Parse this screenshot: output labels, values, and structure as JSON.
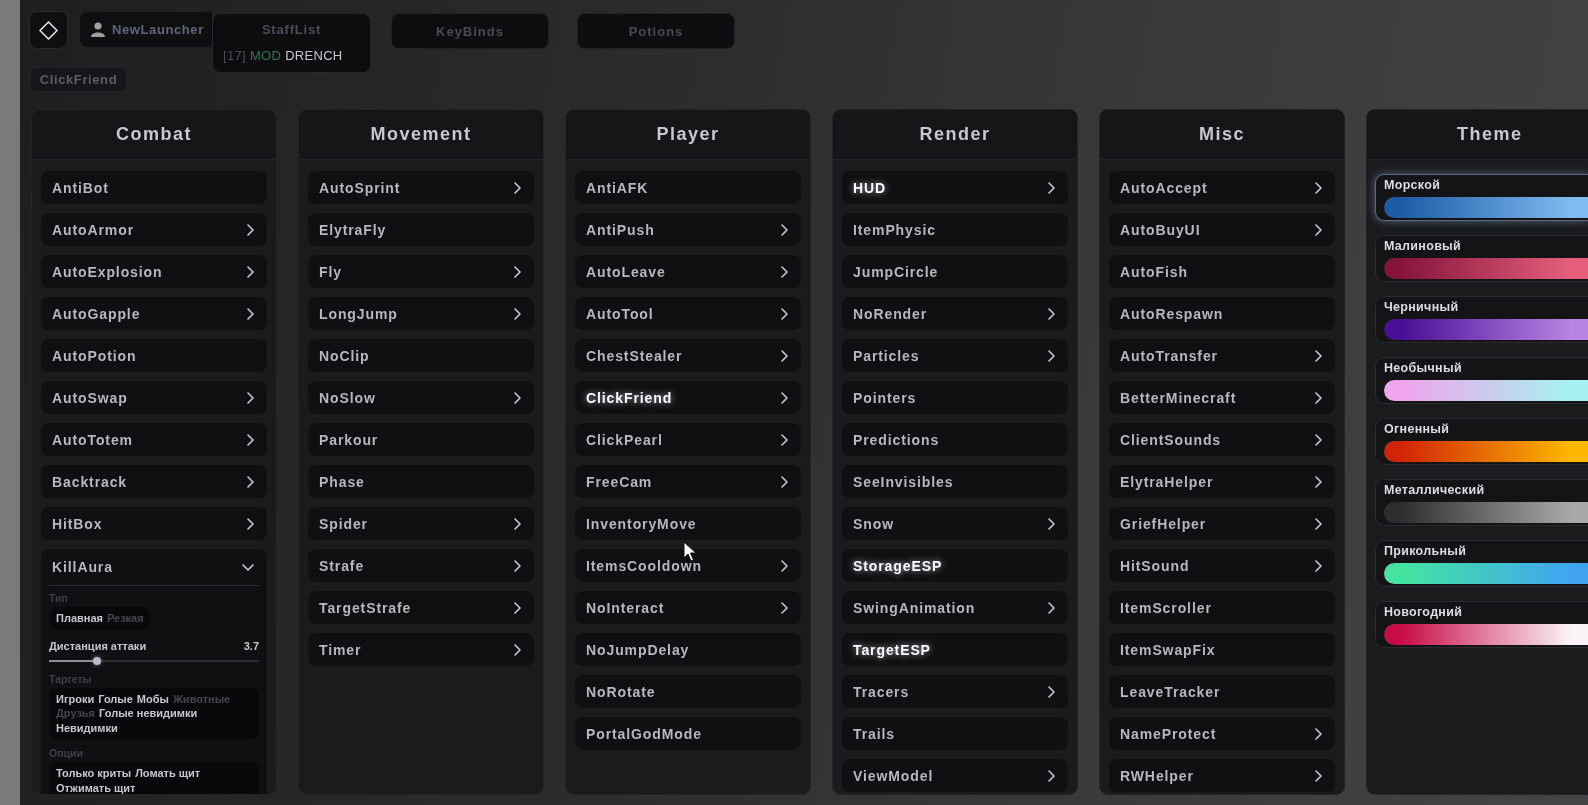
{
  "hud": {
    "watermark": "NewLauncher",
    "staff_list": {
      "title": "StaffList",
      "entries": [
        {
          "prefix": "[17]",
          "role": "MOD",
          "name": "DRENCH",
          "color": "#2f7a4c"
        }
      ]
    },
    "panels": [
      "KeyBinds",
      "Potions"
    ],
    "module_tag": "ClickFriend"
  },
  "categories": [
    {
      "title": "Combat",
      "modules": [
        {
          "label": "AntiBot",
          "kind": "toggle",
          "enabled": false,
          "expanded": false
        },
        {
          "label": "AutoArmor",
          "kind": "submenu",
          "enabled": false,
          "expanded": false
        },
        {
          "label": "AutoExplosion",
          "kind": "submenu",
          "enabled": false,
          "expanded": false
        },
        {
          "label": "AutoGapple",
          "kind": "submenu",
          "enabled": false,
          "expanded": false
        },
        {
          "label": "AutoPotion",
          "kind": "toggle",
          "enabled": false,
          "expanded": false
        },
        {
          "label": "AutoSwap",
          "kind": "submenu",
          "enabled": false,
          "expanded": false
        },
        {
          "label": "AutoTotem",
          "kind": "submenu",
          "enabled": false,
          "expanded": false
        },
        {
          "label": "Backtrack",
          "kind": "submenu",
          "enabled": false,
          "expanded": false
        },
        {
          "label": "HitBox",
          "kind": "submenu",
          "enabled": false,
          "expanded": false
        },
        {
          "label": "KillAura",
          "kind": "submenu",
          "enabled": false,
          "expanded": true,
          "settings": [
            {
              "kind": "mode",
              "label": "Тип",
              "options": [
                {
                  "label": "Плавная",
                  "selected": true
                },
                {
                  "label": "Резкая",
                  "selected": false
                }
              ]
            },
            {
              "kind": "slider",
              "label": "Дистанция аттаки",
              "reading": "3.7",
              "level": 0.23
            },
            {
              "kind": "multi",
              "label": "Таргеты",
              "options": [
                {
                  "label": "Игроки",
                  "selected": true
                },
                {
                  "label": "Голые",
                  "selected": true
                },
                {
                  "label": "Мобы",
                  "selected": true
                },
                {
                  "label": "Животные",
                  "selected": false
                },
                {
                  "label": "Друзья",
                  "selected": false
                },
                {
                  "label": "Голые невидимки",
                  "selected": true
                },
                {
                  "label": "Невидимки",
                  "selected": true
                }
              ]
            },
            {
              "kind": "multi",
              "label": "Опции",
              "options": [
                {
                  "label": "Только криты",
                  "selected": true
                },
                {
                  "label": "Ломать щит",
                  "selected": true
                },
                {
                  "label": "Отжимать щит",
                  "selected": true
                }
              ]
            }
          ]
        }
      ]
    },
    {
      "title": "Movement",
      "modules": [
        {
          "label": "AutoSprint",
          "kind": "submenu",
          "enabled": false,
          "expanded": false
        },
        {
          "label": "ElytraFly",
          "kind": "toggle",
          "enabled": false,
          "expanded": false
        },
        {
          "label": "Fly",
          "kind": "submenu",
          "enabled": false,
          "expanded": false
        },
        {
          "label": "LongJump",
          "kind": "submenu",
          "enabled": false,
          "expanded": false
        },
        {
          "label": "NoClip",
          "kind": "toggle",
          "enabled": false,
          "expanded": false
        },
        {
          "label": "NoSlow",
          "kind": "submenu",
          "enabled": false,
          "expanded": false
        },
        {
          "label": "Parkour",
          "kind": "toggle",
          "enabled": false,
          "expanded": false
        },
        {
          "label": "Phase",
          "kind": "toggle",
          "enabled": false,
          "expanded": false
        },
        {
          "label": "Spider",
          "kind": "submenu",
          "enabled": false,
          "expanded": false
        },
        {
          "label": "Strafe",
          "kind": "submenu",
          "enabled": false,
          "expanded": false
        },
        {
          "label": "TargetStrafe",
          "kind": "submenu",
          "enabled": false,
          "expanded": false
        },
        {
          "label": "Timer",
          "kind": "submenu",
          "enabled": false,
          "expanded": false
        }
      ]
    },
    {
      "title": "Player",
      "modules": [
        {
          "label": "AntiAFK",
          "kind": "toggle",
          "enabled": false,
          "expanded": false
        },
        {
          "label": "AntiPush",
          "kind": "submenu",
          "enabled": false,
          "expanded": false
        },
        {
          "label": "AutoLeave",
          "kind": "submenu",
          "enabled": false,
          "expanded": false
        },
        {
          "label": "AutoTool",
          "kind": "submenu",
          "enabled": false,
          "expanded": false
        },
        {
          "label": "ChestStealer",
          "kind": "submenu",
          "enabled": false,
          "expanded": false
        },
        {
          "label": "ClickFriend",
          "kind": "submenu",
          "enabled": true,
          "expanded": false
        },
        {
          "label": "ClickPearl",
          "kind": "submenu",
          "enabled": false,
          "expanded": false
        },
        {
          "label": "FreeCam",
          "kind": "submenu",
          "enabled": false,
          "expanded": false
        },
        {
          "label": "InventoryMove",
          "kind": "toggle",
          "enabled": false,
          "expanded": false
        },
        {
          "label": "ItemsCooldown",
          "kind": "submenu",
          "enabled": false,
          "expanded": false
        },
        {
          "label": "NoInteract",
          "kind": "submenu",
          "enabled": false,
          "expanded": false
        },
        {
          "label": "NoJumpDelay",
          "kind": "toggle",
          "enabled": false,
          "expanded": false
        },
        {
          "label": "NoRotate",
          "kind": "toggle",
          "enabled": false,
          "expanded": false
        },
        {
          "label": "PortalGodMode",
          "kind": "toggle",
          "enabled": false,
          "expanded": false
        }
      ]
    },
    {
      "title": "Render",
      "modules": [
        {
          "label": "HUD",
          "kind": "submenu",
          "enabled": true,
          "expanded": false
        },
        {
          "label": "ItemPhysic",
          "kind": "toggle",
          "enabled": false,
          "expanded": false
        },
        {
          "label": "JumpCircle",
          "kind": "toggle",
          "enabled": false,
          "expanded": false
        },
        {
          "label": "NoRender",
          "kind": "submenu",
          "enabled": false,
          "expanded": false
        },
        {
          "label": "Particles",
          "kind": "submenu",
          "enabled": false,
          "expanded": false
        },
        {
          "label": "Pointers",
          "kind": "toggle",
          "enabled": false,
          "expanded": false
        },
        {
          "label": "Predictions",
          "kind": "toggle",
          "enabled": false,
          "expanded": false
        },
        {
          "label": "SeeInvisibles",
          "kind": "toggle",
          "enabled": false,
          "expanded": false
        },
        {
          "label": "Snow",
          "kind": "submenu",
          "enabled": false,
          "expanded": false
        },
        {
          "label": "StorageESP",
          "kind": "toggle",
          "enabled": true,
          "expanded": false
        },
        {
          "label": "SwingAnimation",
          "kind": "submenu",
          "enabled": false,
          "expanded": false
        },
        {
          "label": "TargetESP",
          "kind": "toggle",
          "enabled": true,
          "expanded": false
        },
        {
          "label": "Tracers",
          "kind": "submenu",
          "enabled": false,
          "expanded": false
        },
        {
          "label": "Trails",
          "kind": "toggle",
          "enabled": false,
          "expanded": false
        },
        {
          "label": "ViewModel",
          "kind": "submenu",
          "enabled": false,
          "expanded": false
        }
      ]
    },
    {
      "title": "Misc",
      "modules": [
        {
          "label": "AutoAccept",
          "kind": "submenu",
          "enabled": false,
          "expanded": false
        },
        {
          "label": "AutoBuyUI",
          "kind": "submenu",
          "enabled": false,
          "expanded": false
        },
        {
          "label": "AutoFish",
          "kind": "toggle",
          "enabled": false,
          "expanded": false
        },
        {
          "label": "AutoRespawn",
          "kind": "toggle",
          "enabled": false,
          "expanded": false
        },
        {
          "label": "AutoTransfer",
          "kind": "submenu",
          "enabled": false,
          "expanded": false
        },
        {
          "label": "BetterMinecraft",
          "kind": "submenu",
          "enabled": false,
          "expanded": false
        },
        {
          "label": "ClientSounds",
          "kind": "submenu",
          "enabled": false,
          "expanded": false
        },
        {
          "label": "ElytraHelper",
          "kind": "submenu",
          "enabled": false,
          "expanded": false
        },
        {
          "label": "GriefHelper",
          "kind": "submenu",
          "enabled": false,
          "expanded": false
        },
        {
          "label": "HitSound",
          "kind": "submenu",
          "enabled": false,
          "expanded": false
        },
        {
          "label": "ItemScroller",
          "kind": "toggle",
          "enabled": false,
          "expanded": false
        },
        {
          "label": "ItemSwapFix",
          "kind": "toggle",
          "enabled": false,
          "expanded": false
        },
        {
          "label": "LeaveTracker",
          "kind": "toggle",
          "enabled": false,
          "expanded": false
        },
        {
          "label": "NameProtect",
          "kind": "submenu",
          "enabled": false,
          "expanded": false
        },
        {
          "label": "RWHelper",
          "kind": "submenu",
          "enabled": false,
          "expanded": false
        }
      ]
    }
  ],
  "theme": {
    "title": "Theme",
    "items": [
      {
        "label": "Морской",
        "selected": true,
        "gradient": [
          {
            "color": "#1b5ca4"
          },
          {
            "color": "#80baf0"
          }
        ]
      },
      {
        "label": "Малиновый",
        "selected": false,
        "gradient": [
          {
            "color": "#86143a"
          },
          {
            "color": "#e6607e"
          }
        ]
      },
      {
        "label": "Черничный",
        "selected": false,
        "gradient": [
          {
            "color": "#4a0e96"
          },
          {
            "color": "#ba84e4"
          }
        ]
      },
      {
        "label": "Необычный",
        "selected": false,
        "gradient": [
          {
            "color": "#f0a4ec"
          },
          {
            "color": "#a6f2f0"
          }
        ]
      },
      {
        "label": "Огненный",
        "selected": false,
        "gradient": [
          {
            "color": "#d22408"
          },
          {
            "color": "#fcb800"
          }
        ]
      },
      {
        "label": "Металлический",
        "selected": false,
        "gradient": [
          {
            "color": "#2e2e30"
          },
          {
            "color": "#a9a9a9"
          }
        ]
      },
      {
        "label": "Прикольный",
        "selected": false,
        "gradient": [
          {
            "color": "#44e4a0"
          },
          {
            "color": "#40a4f2"
          }
        ]
      },
      {
        "label": "Новогодний",
        "selected": false,
        "gradient": [
          {
            "color": "#c80c46"
          },
          {
            "color": "#faf4f8"
          }
        ]
      }
    ]
  }
}
